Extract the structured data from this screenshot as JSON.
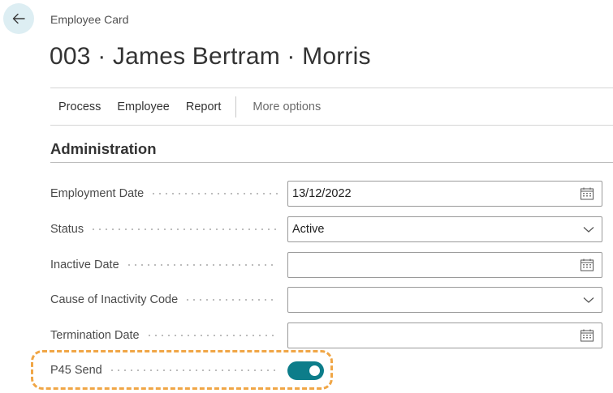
{
  "header": {
    "caption": "Employee Card",
    "title": "003 · James Bertram · Morris"
  },
  "actions": {
    "process": "Process",
    "employee": "Employee",
    "report": "Report",
    "more": "More options"
  },
  "section": {
    "title": "Administration"
  },
  "fields": {
    "employment_date": {
      "label": "Employment Date",
      "value": "13/12/2022",
      "icon": "calendar-icon"
    },
    "status": {
      "label": "Status",
      "value": "Active",
      "icon": "chevron-down-icon"
    },
    "inactive_date": {
      "label": "Inactive Date",
      "value": "",
      "icon": "calendar-icon"
    },
    "cause_of_inactivity": {
      "label": "Cause of Inactivity Code",
      "value": "",
      "icon": "chevron-down-icon"
    },
    "termination_date": {
      "label": "Termination Date",
      "value": "",
      "icon": "calendar-icon"
    },
    "p45_send": {
      "label": "P45 Send",
      "value": true
    }
  },
  "colors": {
    "toggle_on": "#0d7d8a",
    "highlight": "#f0a646",
    "back_button_bg": "#ddeef3"
  }
}
